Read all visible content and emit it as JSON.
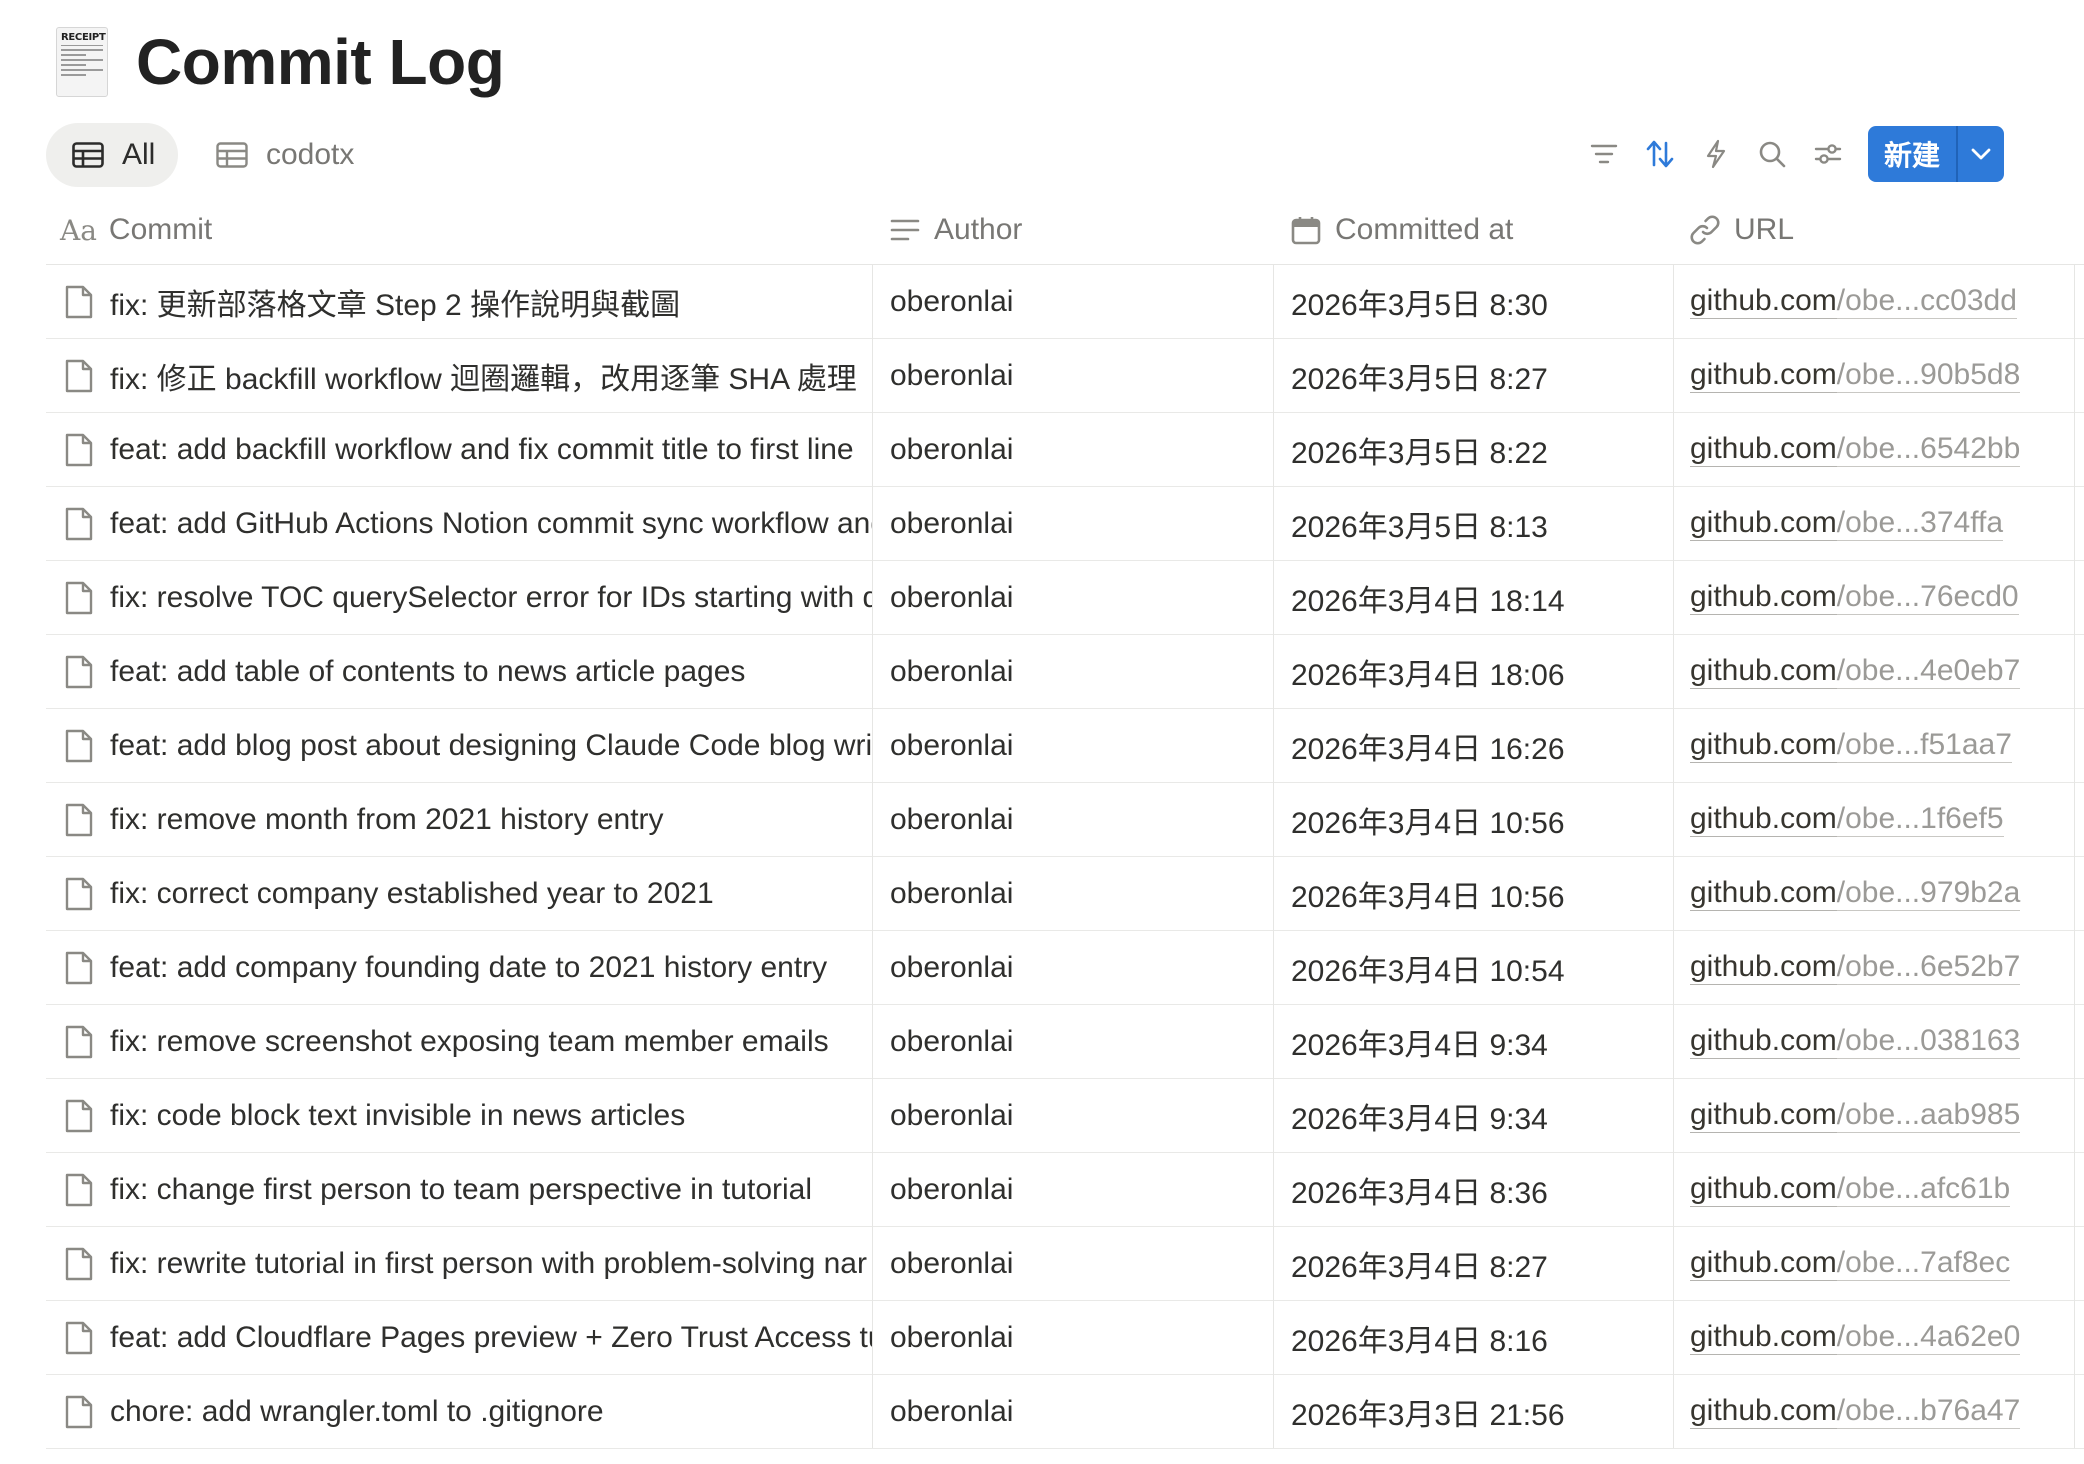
{
  "page": {
    "title": "Commit Log",
    "icon": "receipt-icon",
    "icon_text": "RECEIPT"
  },
  "views": [
    {
      "label": "All",
      "icon": "table-icon",
      "active": true
    },
    {
      "label": "codotx",
      "icon": "table-icon",
      "active": false
    }
  ],
  "toolbar": {
    "icons": [
      "filter-icon",
      "sort-icon",
      "lightning-icon",
      "search-icon",
      "settings-sliders-icon"
    ],
    "sort_active_color": "#2e7ad9",
    "new_button_label": "新建",
    "new_button_color": "#2e7ad9"
  },
  "columns": [
    {
      "label": "Commit",
      "icon": "text-aa-icon"
    },
    {
      "label": "Author",
      "icon": "lines-icon"
    },
    {
      "label": "Committed at",
      "icon": "calendar-icon"
    },
    {
      "label": "URL",
      "icon": "link-icon"
    }
  ],
  "rows": [
    {
      "commit": "fix: 更新部落格文章 Step 2 操作說明與截圖",
      "author": "oberonlai",
      "committed_at": "2026年3月5日 8:30",
      "url_host": "github.com",
      "url_path": "/obe...cc03dd"
    },
    {
      "commit": "fix: 修正 backfill workflow 迴圈邏輯，改用逐筆 SHA 處理",
      "author": "oberonlai",
      "committed_at": "2026年3月5日 8:27",
      "url_host": "github.com",
      "url_path": "/obe...90b5d8"
    },
    {
      "commit": "feat: add backfill workflow and fix commit title to first line",
      "author": "oberonlai",
      "committed_at": "2026年3月5日 8:22",
      "url_host": "github.com",
      "url_path": "/obe...6542bb"
    },
    {
      "commit": "feat: add GitHub Actions Notion commit sync workflow and",
      "author": "oberonlai",
      "committed_at": "2026年3月5日 8:13",
      "url_host": "github.com",
      "url_path": "/obe...374ffa"
    },
    {
      "commit": "fix: resolve TOC querySelector error for IDs starting with d",
      "author": "oberonlai",
      "committed_at": "2026年3月4日 18:14",
      "url_host": "github.com",
      "url_path": "/obe...76ecd0"
    },
    {
      "commit": "feat: add table of contents to news article pages",
      "author": "oberonlai",
      "committed_at": "2026年3月4日 18:06",
      "url_host": "github.com",
      "url_path": "/obe...4e0eb7"
    },
    {
      "commit": "feat: add blog post about designing Claude Code blog writ",
      "author": "oberonlai",
      "committed_at": "2026年3月4日 16:26",
      "url_host": "github.com",
      "url_path": "/obe...f51aa7"
    },
    {
      "commit": "fix: remove month from 2021 history entry",
      "author": "oberonlai",
      "committed_at": "2026年3月4日 10:56",
      "url_host": "github.com",
      "url_path": "/obe...1f6ef5"
    },
    {
      "commit": "fix: correct company established year to 2021",
      "author": "oberonlai",
      "committed_at": "2026年3月4日 10:56",
      "url_host": "github.com",
      "url_path": "/obe...979b2a"
    },
    {
      "commit": "feat: add company founding date to 2021 history entry",
      "author": "oberonlai",
      "committed_at": "2026年3月4日 10:54",
      "url_host": "github.com",
      "url_path": "/obe...6e52b7"
    },
    {
      "commit": "fix: remove screenshot exposing team member emails",
      "author": "oberonlai",
      "committed_at": "2026年3月4日 9:34",
      "url_host": "github.com",
      "url_path": "/obe...038163"
    },
    {
      "commit": "fix: code block text invisible in news articles",
      "author": "oberonlai",
      "committed_at": "2026年3月4日 9:34",
      "url_host": "github.com",
      "url_path": "/obe...aab985"
    },
    {
      "commit": "fix: change first person to team perspective in tutorial",
      "author": "oberonlai",
      "committed_at": "2026年3月4日 8:36",
      "url_host": "github.com",
      "url_path": "/obe...afc61b"
    },
    {
      "commit": "fix: rewrite tutorial in first person with problem-solving nar",
      "author": "oberonlai",
      "committed_at": "2026年3月4日 8:27",
      "url_host": "github.com",
      "url_path": "/obe...7af8ec"
    },
    {
      "commit": "feat: add Cloudflare Pages preview + Zero Trust Access tu",
      "author": "oberonlai",
      "committed_at": "2026年3月4日 8:16",
      "url_host": "github.com",
      "url_path": "/obe...4a62e0"
    },
    {
      "commit": "chore: add wrangler.toml to .gitignore",
      "author": "oberonlai",
      "committed_at": "2026年3月3日 21:56",
      "url_host": "github.com",
      "url_path": "/obe...b76a47"
    }
  ]
}
